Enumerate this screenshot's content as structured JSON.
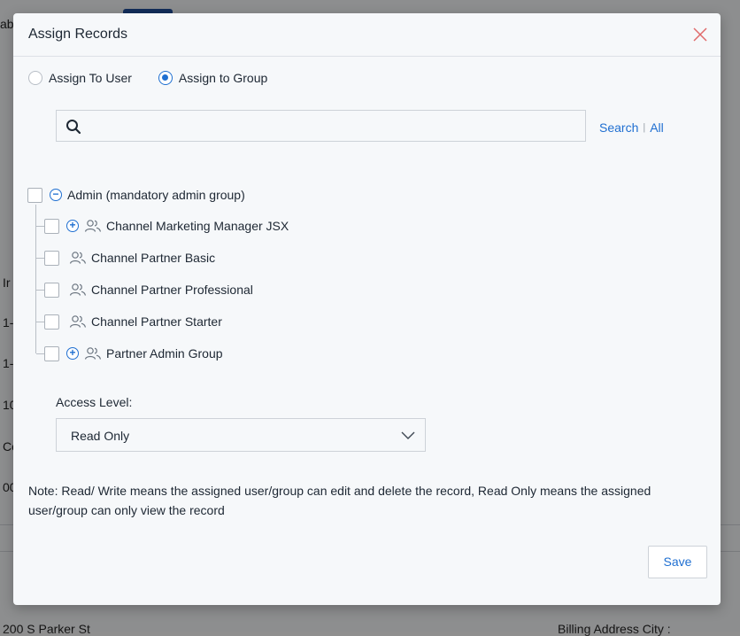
{
  "background": {
    "top_tab_fragment": "ab",
    "row_fragments": [
      "Ir",
      "1-",
      "1-",
      "10",
      "Co",
      "00"
    ],
    "billing_street": "200 S Parker St",
    "billing_city_label": "Billing Address City :"
  },
  "modal": {
    "title": "Assign Records",
    "close_icon": "close-icon",
    "assign_options": [
      {
        "label": "Assign To User",
        "checked": false
      },
      {
        "label": "Assign to Group",
        "checked": true
      }
    ],
    "search": {
      "placeholder": "",
      "value": "",
      "search_link": "Search",
      "separator": "|",
      "all_link": "All"
    },
    "tree": {
      "root": {
        "label": "Admin (mandatory admin group)",
        "expanded": true
      },
      "children": [
        {
          "label": "Channel Marketing Manager JSX",
          "expandable": true
        },
        {
          "label": "Channel Partner Basic",
          "expandable": false
        },
        {
          "label": "Channel Partner Professional",
          "expandable": false
        },
        {
          "label": "Channel Partner Starter",
          "expandable": false
        },
        {
          "label": "Partner Admin Group",
          "expandable": true
        }
      ]
    },
    "access_level": {
      "label": "Access Level:",
      "selected": "Read Only"
    },
    "note": "Note: Read/ Write means the assigned user/group can edit and delete the record, Read Only means the assigned user/group can only view the record",
    "save_label": "Save"
  },
  "colors": {
    "accent": "#1f6fd1",
    "close": "#e06a6a"
  }
}
